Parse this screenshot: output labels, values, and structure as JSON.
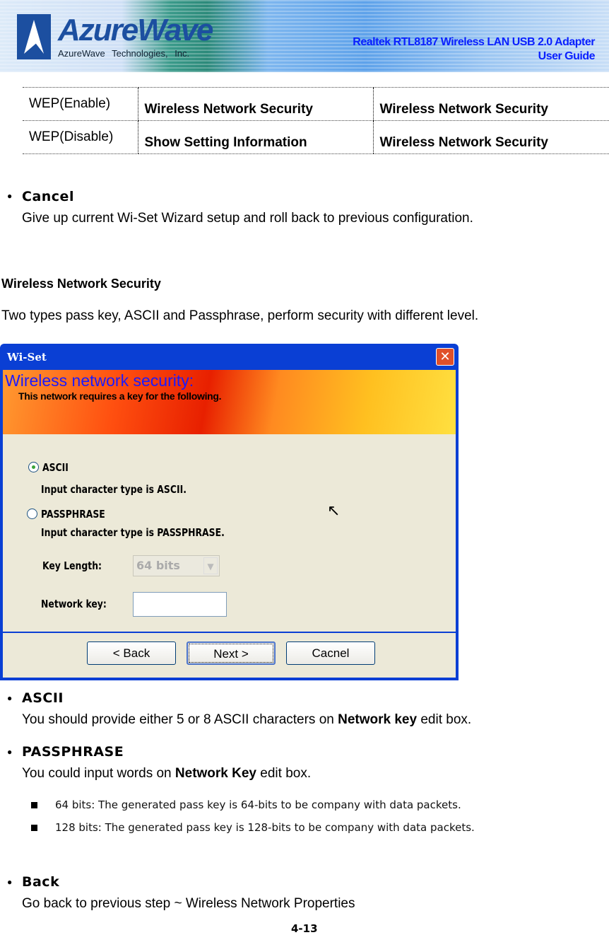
{
  "header": {
    "logo": "AzureWave",
    "company": "AzureWave  Technologies,  Inc.",
    "product": "Realtek RTL8187 Wireless LAN USB 2.0 Adapter",
    "guide": "User Guide"
  },
  "wep_table": [
    [
      "WEP(Enable)",
      "Wireless Network Security",
      "Wireless Network Security"
    ],
    [
      "WEP(Disable)",
      "Show Setting Information",
      "Wireless Network Security"
    ]
  ],
  "cancel": {
    "title": "Cancel",
    "text": "Give up current Wi-Set Wizard setup and roll back to previous configuration."
  },
  "section": {
    "title": "Wireless Network Security",
    "intro": "Two types pass key, ASCII and Passphrase, perform security with different level."
  },
  "dialog": {
    "title": "Wi-Set",
    "close": "✕",
    "heading": "Wireless network security:",
    "subheading": "This network requires a key for the following.",
    "options": [
      {
        "label": "ASCII",
        "desc": "Input character type is ASCII.",
        "selected": true
      },
      {
        "label": "PASSPHRASE",
        "desc": "Input character type is PASSPHRASE.",
        "selected": false
      }
    ],
    "key_length_label": "Key Length:",
    "key_length_value": "64 bits",
    "network_key_label": "Network key:",
    "network_key_value": "",
    "buttons": {
      "back": "< Back",
      "next": "Next >",
      "cancel": "Cacnel"
    }
  },
  "ascii": {
    "title": "ASCII",
    "pre": "You should provide either 5 or 8 ASCII characters on ",
    "bold": "Network key",
    "post": " edit box."
  },
  "passphrase": {
    "title": "PASSPHRASE",
    "pre": "You could input words on ",
    "bold": "Network Key",
    "post": " edit box.",
    "items": [
      "64 bits: The generated pass key is 64-bits to be company with data packets.",
      "128 bits: The generated pass key is 128-bits to be company with data packets."
    ]
  },
  "back": {
    "title": "Back",
    "text": "Go back to previous step ~ Wireless Network Properties"
  },
  "page_number": "4-13"
}
